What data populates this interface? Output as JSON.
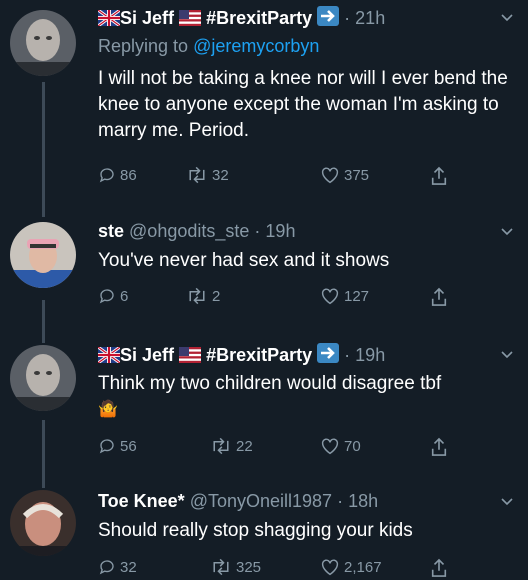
{
  "tweets": [
    {
      "name": "Si Jeff",
      "hashtag": "#BrexitParty",
      "handle": "",
      "time": "21h",
      "replying_prefix": "Replying to",
      "replying_to": "@jeremycorbyn",
      "text": "I will not be taking a knee nor will I ever bend the knee to anyone except the woman I'm asking to marry me. Period.",
      "replies": "86",
      "retweets": "32",
      "likes": "375"
    },
    {
      "name": "ste",
      "handle": "@ohgodits_ste",
      "time": "19h",
      "text": "You've never had sex and it shows",
      "replies": "6",
      "retweets": "2",
      "likes": "127"
    },
    {
      "name": "Si Jeff",
      "hashtag": "#BrexitParty",
      "handle": "",
      "time": "19h",
      "text": "Think my two children would disagree tbf",
      "emoji": "🤷",
      "replies": "56",
      "retweets": "22",
      "likes": "70"
    },
    {
      "name": "Toe Knee*",
      "handle": "@TonyOneill1987",
      "time": "18h",
      "text": "Should really stop shagging your kids",
      "replies": "32",
      "retweets": "325",
      "likes": "2,167"
    }
  ],
  "dot": "·",
  "colors": {
    "background": "#141d26",
    "muted": "#8899a6",
    "link": "#1da1f2"
  },
  "icons": [
    "reply-icon",
    "retweet-icon",
    "like-icon",
    "share-icon",
    "chevron-down-icon",
    "uk-flag-icon",
    "us-flag-icon",
    "arrow-right-icon"
  ]
}
